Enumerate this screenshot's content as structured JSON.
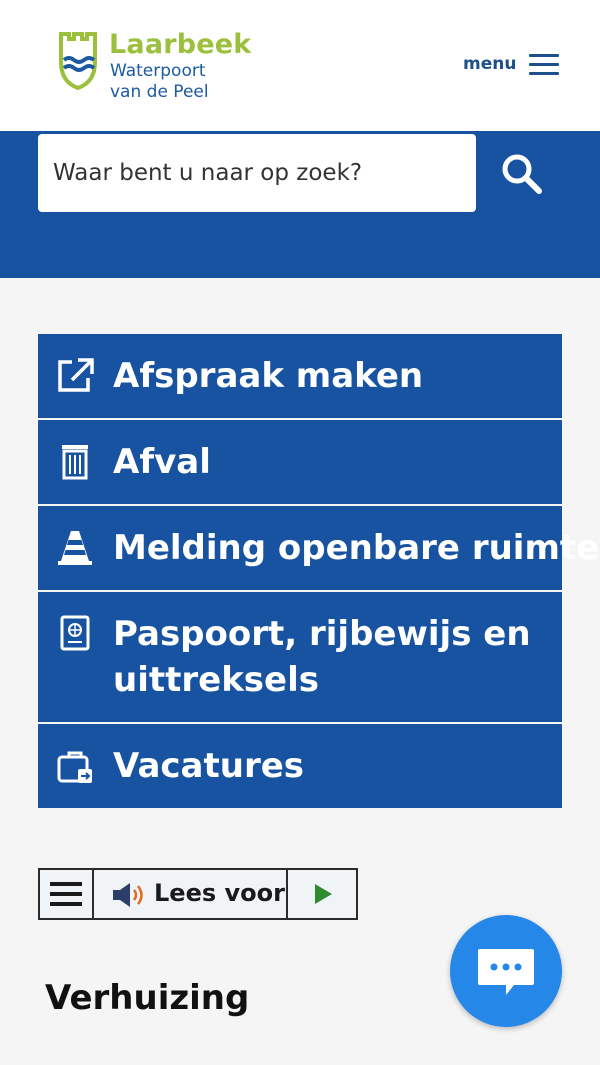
{
  "header": {
    "logo": {
      "name": "Laarbeek",
      "tagline_line1": "Waterpoort",
      "tagline_line2": "van de Peel"
    },
    "menu_label": "menu"
  },
  "search": {
    "placeholder": "Waar bent u naar op zoek?"
  },
  "tiles": [
    {
      "icon": "external-link-icon",
      "label": "Afspraak maken"
    },
    {
      "icon": "trash-bin-icon",
      "label": "Afval"
    },
    {
      "icon": "traffic-cone-icon",
      "label": "Melding openbare ruimte"
    },
    {
      "icon": "passport-icon",
      "label": "Paspoort, rijbewijs en",
      "label_line2": "uittreksels"
    },
    {
      "icon": "briefcase-icon",
      "label": "Vacatures"
    }
  ],
  "readspeaker": {
    "label": "Lees voor"
  },
  "section": {
    "title": "Verhuizing"
  },
  "colors": {
    "primary_blue": "#1753a0",
    "logo_green": "#9bc13c",
    "chat_blue": "#2587e8",
    "play_green": "#2e8b2e"
  }
}
